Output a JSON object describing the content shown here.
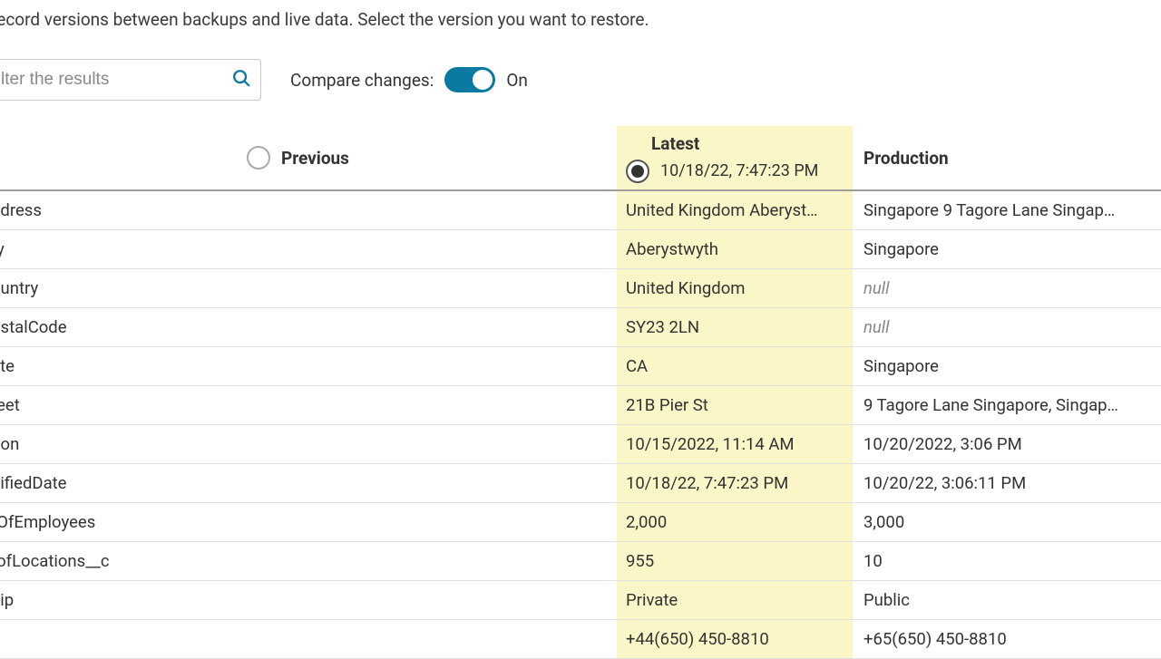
{
  "instruction": "record versions between backups and live data. Select the version you want to restore.",
  "search": {
    "placeholder": "lter the results"
  },
  "compare": {
    "label": "Compare changes:",
    "state": "On"
  },
  "columns": {
    "previous": "Previous",
    "latest": {
      "label": "Latest",
      "timestamp": "10/18/22, 7:47:23 PM"
    },
    "production": "Production"
  },
  "rows": [
    {
      "field": "ddress",
      "latest": "United Kingdom Aberyst…",
      "prod": "Singapore 9 Tagore Lane Singap…"
    },
    {
      "field": "ty",
      "latest": "Aberystwyth",
      "prod": "Singapore"
    },
    {
      "field": "ountry",
      "latest": "United Kingdom",
      "prod": null
    },
    {
      "field": "ostalCode",
      "latest": "SY23 2LN",
      "prod": null
    },
    {
      "field": "ate",
      "latest": "CA",
      "prod": "Singapore"
    },
    {
      "field": "reet",
      "latest": "21B Pier St",
      "prod": "9 Tagore Lane Singapore, Singap…"
    },
    {
      "field": "tion",
      "latest": "10/15/2022, 11:14 AM",
      "prod": "10/20/2022, 3:06 PM"
    },
    {
      "field": "difiedDate",
      "latest": "10/18/22, 7:47:23 PM",
      "prod": "10/20/22, 3:06:11 PM"
    },
    {
      "field": "rOfEmployees",
      "latest": "2,000",
      "prod": "3,000"
    },
    {
      "field": "rofLocations__c",
      "latest": "955",
      "prod": "10"
    },
    {
      "field": "hip",
      "latest": "Private",
      "prod": "Public"
    },
    {
      "field": "",
      "latest": "+44(650) 450-8810",
      "prod": "+65(650) 450-8810"
    }
  ]
}
